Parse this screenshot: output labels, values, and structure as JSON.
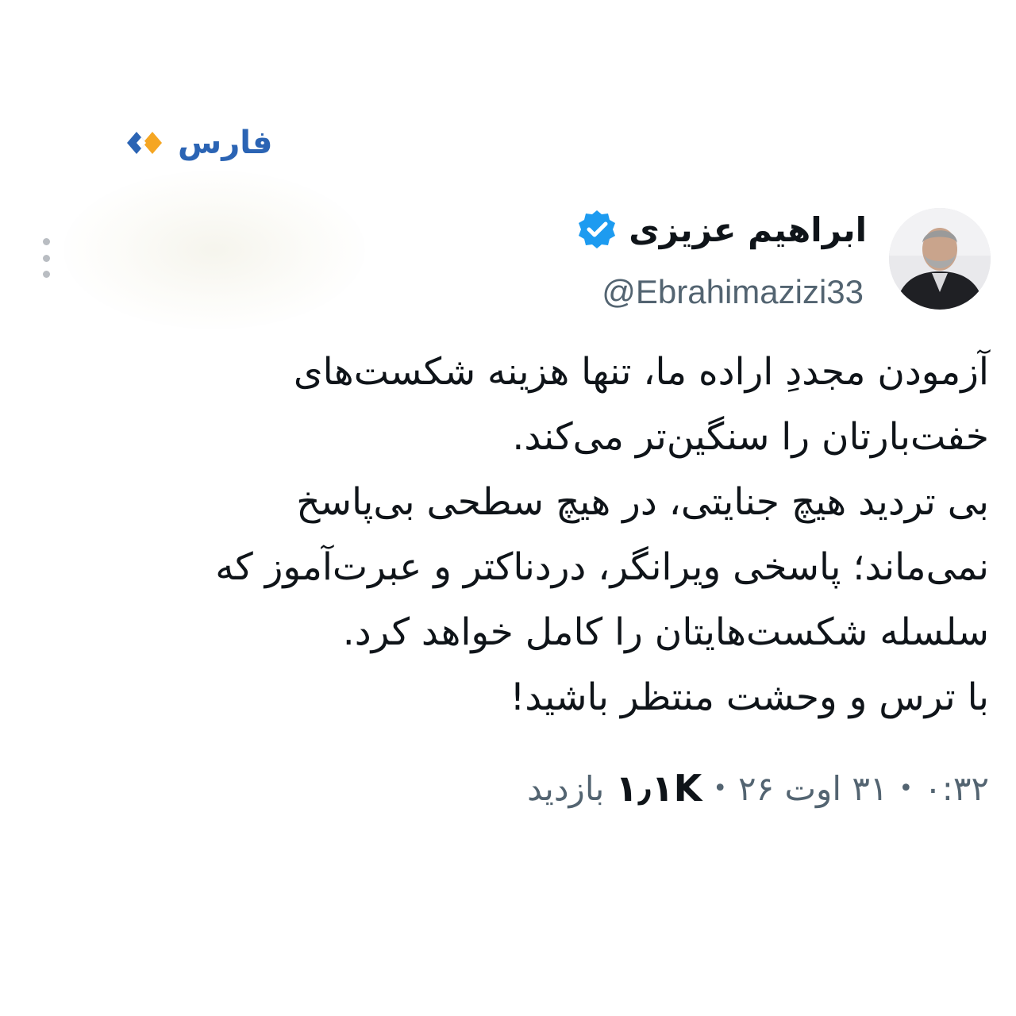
{
  "brand": {
    "name": "فارس",
    "icon": "fars-logo-icon",
    "colors": {
      "text": "#2b64b4",
      "mark_orange": "#f5a623",
      "mark_blue": "#2b64b4"
    }
  },
  "tweet": {
    "display_name": "ابراهیم عزیزی",
    "handle": "@Ebrahimazizi33",
    "verified_icon": "verified-badge-icon",
    "body_lines": [
      "آزمودن مجددِ اراده ما، تنها هزینه شکست‌های",
      "خفت‌بارتان را سنگین‌تر می‌کند.",
      "بی تردید هیچ جنایتی، در هیچ سطحی بی‌پاسخ",
      "نمی‌ماند؛ پاسخی ویرانگر، دردناکتر و عبرت‌آموز که",
      "سلسله شکست‌هایتان را کامل خواهد کرد.",
      "با ترس و وحشت منتظر باشید!"
    ],
    "meta": {
      "time": "۰:۳۲",
      "separator": "•",
      "date": "۳۱ اوت ۲۶",
      "views_count": "۱٫۱K",
      "views_label": "بازدید"
    }
  },
  "more_icon": "more-vertical-icon",
  "colors": {
    "text": "#0f1419",
    "secondary": "#536471",
    "verified": "#1d9bf0"
  }
}
